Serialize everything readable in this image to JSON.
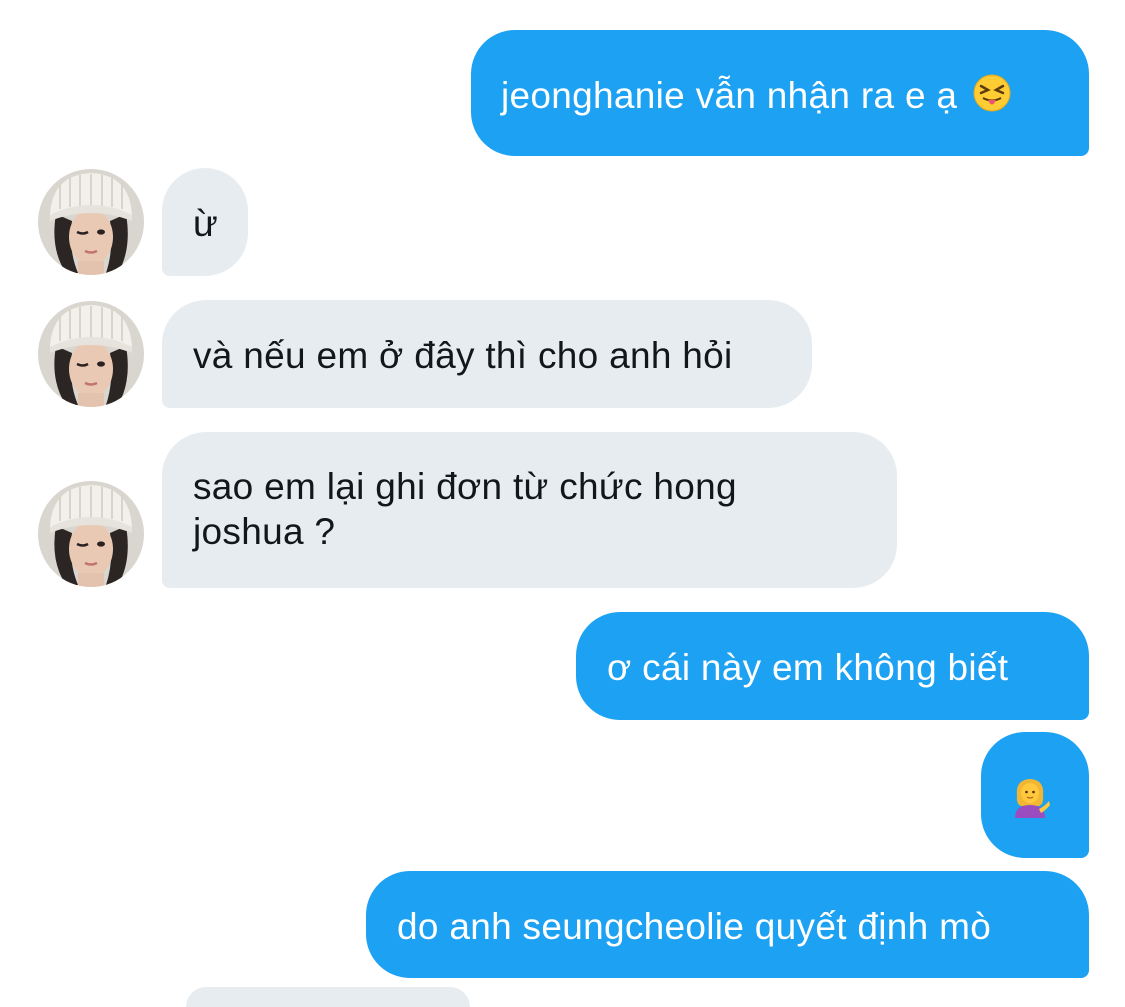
{
  "conversation": {
    "messages": [
      {
        "from": "me",
        "text": "jeonghanie vẫn nhận ra e ạ",
        "emoji": "squinting-face-with-tongue-icon"
      },
      {
        "from": "them",
        "text": "ừ"
      },
      {
        "from": "them",
        "text": "và nếu em ở đây thì cho anh hỏi"
      },
      {
        "from": "them",
        "text_line1": "sao em lại ghi đơn từ chức hong",
        "text_line2": "joshua ?"
      },
      {
        "from": "me",
        "text": "ơ cái này em không biết"
      },
      {
        "from": "me",
        "text": "",
        "emoji": "woman-tipping-hand-icon"
      },
      {
        "from": "me",
        "text": "do anh seungcheolie quyết định mò"
      }
    ]
  },
  "colors": {
    "sent_bubble": "#1da1f2",
    "sent_text": "#ffffff",
    "received_bubble": "#e6ecf0",
    "received_text": "#14171a"
  }
}
